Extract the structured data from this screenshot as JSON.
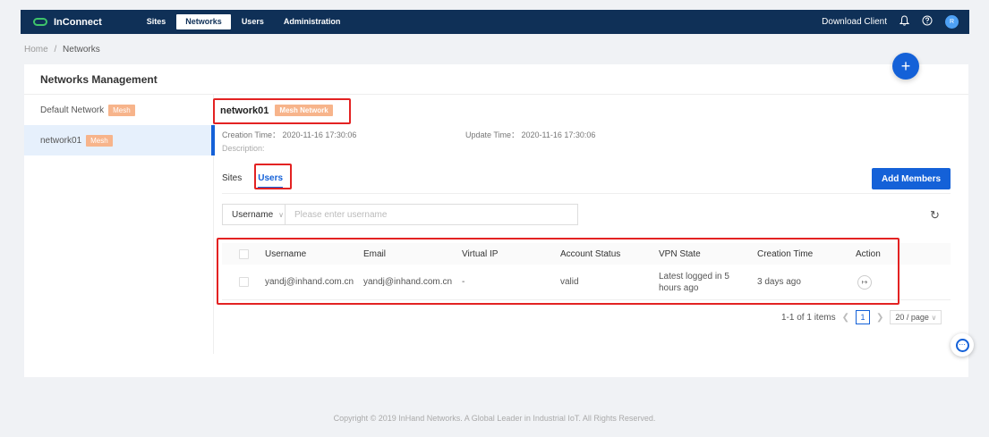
{
  "app": {
    "name": "InConnect"
  },
  "nav": [
    {
      "label": "Sites",
      "active": false
    },
    {
      "label": "Networks",
      "active": true
    },
    {
      "label": "Users",
      "active": false
    },
    {
      "label": "Administration",
      "active": false
    }
  ],
  "topbar": {
    "download_label": "Download Client",
    "avatar_letter": "R"
  },
  "breadcrumb": {
    "home": "Home",
    "separator": "/",
    "current": "Networks"
  },
  "page": {
    "title": "Networks Management",
    "add_button": "+"
  },
  "sidebar": {
    "items": [
      {
        "label": "Default Network",
        "tag": "Mesh",
        "active": false
      },
      {
        "label": "network01",
        "tag": "Mesh",
        "active": true
      }
    ]
  },
  "detail": {
    "name": "network01",
    "type_tag": "Mesh Network",
    "creation_time": "Creation Time： 2020-11-16 17:30:06",
    "update_time": "Update Time： 2020-11-16 17:30:06",
    "description": "Description:"
  },
  "tabs": [
    {
      "label": "Sites",
      "active": false
    },
    {
      "label": "Users",
      "active": true
    }
  ],
  "add_members": "Add Members",
  "search": {
    "field": "Username",
    "placeholder": "Please enter username"
  },
  "table": {
    "columns": [
      "Username",
      "Email",
      "Virtual IP",
      "Account Status",
      "VPN State",
      "Creation Time",
      "Action"
    ],
    "rows": [
      {
        "username": "yandj@inhand.com.cn",
        "email": "yandj@inhand.com.cn",
        "virtual_ip": "-",
        "status": "valid",
        "vpn_state": "Latest logged in 5 hours ago",
        "creation": "3 days ago",
        "action_icon": "logout-icon"
      }
    ]
  },
  "pagination": {
    "summary": "1-1 of 1 items",
    "current": "1",
    "page_size": "20 / page"
  },
  "footer": "Copyright © 2019 InHand Networks. A Global Leader in Industrial IoT. All Rights Reserved.",
  "colors": {
    "topbar": "#0f3057",
    "primary": "#1461d8",
    "tag": "#f7b48b",
    "highlight": "#e32222",
    "logo": "#3fc46b"
  }
}
